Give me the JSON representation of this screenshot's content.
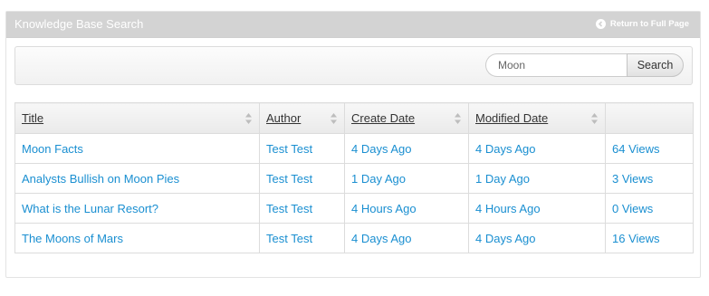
{
  "header": {
    "title": "Knowledge Base Search",
    "return_label": "Return to Full Page"
  },
  "search": {
    "value": "Moon",
    "button_label": "Search"
  },
  "table": {
    "columns": [
      "Title",
      "Author",
      "Create Date",
      "Modified Date",
      ""
    ],
    "rows": [
      {
        "title": "Moon Facts",
        "author": "Test Test",
        "created": "4 Days Ago",
        "modified": "4 Days Ago",
        "views": "64 Views"
      },
      {
        "title": "Analysts Bullish on Moon Pies",
        "author": "Test Test",
        "created": "1 Day Ago",
        "modified": "1 Day Ago",
        "views": "3 Views"
      },
      {
        "title": "What is the Lunar Resort?",
        "author": "Test Test",
        "created": "4 Hours Ago",
        "modified": "4 Hours Ago",
        "views": "0 Views"
      },
      {
        "title": "The Moons of Mars",
        "author": "Test Test",
        "created": "4 Days Ago",
        "modified": "4 Days Ago",
        "views": "16 Views"
      }
    ]
  },
  "colors": {
    "header_bg": "#d3d3d3",
    "link": "#1a8fd1"
  },
  "icons": {
    "return": "return-arrow-icon",
    "sort": "sort-arrows-icon"
  }
}
